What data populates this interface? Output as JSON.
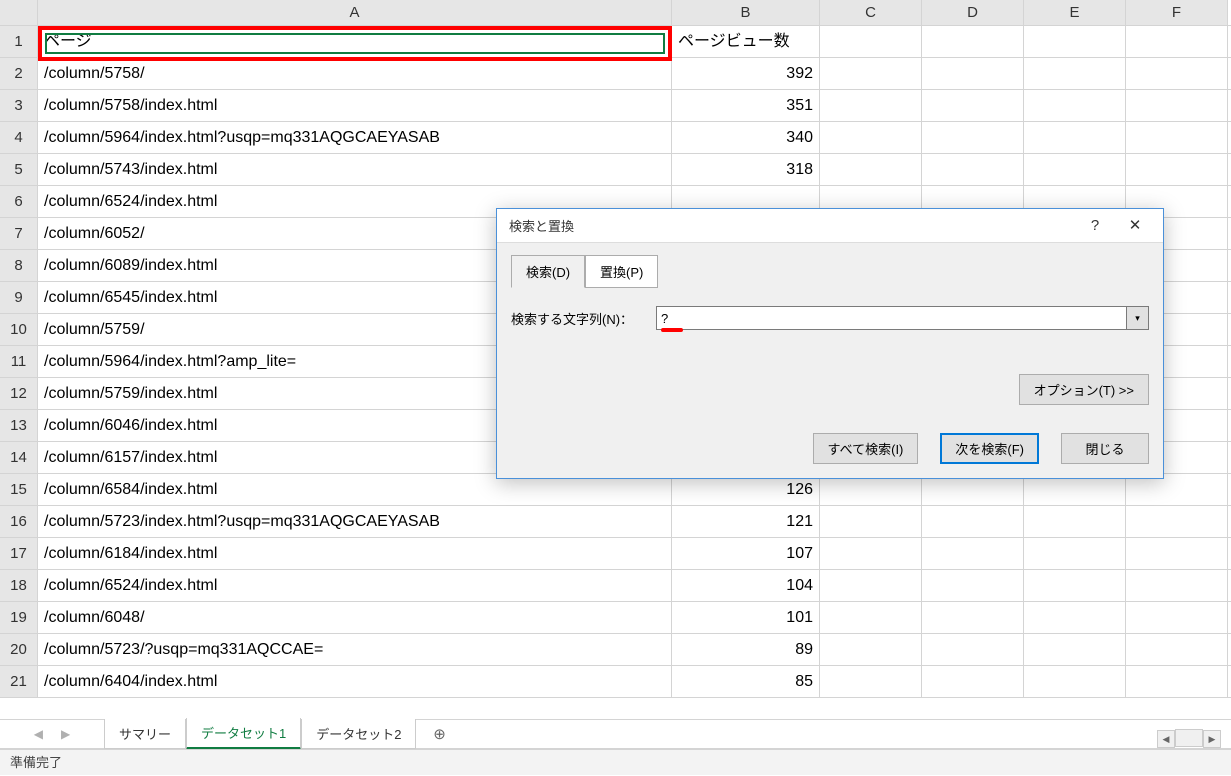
{
  "columns": [
    "A",
    "B",
    "C",
    "D",
    "E",
    "F"
  ],
  "rows": [
    {
      "n": 1,
      "a": "ページ",
      "b": "ページビュー数"
    },
    {
      "n": 2,
      "a": "/column/5758/",
      "b": "392"
    },
    {
      "n": 3,
      "a": "/column/5758/index.html",
      "b": "351"
    },
    {
      "n": 4,
      "a": "/column/5964/index.html?usqp=mq331AQGCAEYASAB",
      "b": "340"
    },
    {
      "n": 5,
      "a": "/column/5743/index.html",
      "b": "318"
    },
    {
      "n": 6,
      "a": "/column/6524/index.html",
      "b": ""
    },
    {
      "n": 7,
      "a": "/column/6052/",
      "b": ""
    },
    {
      "n": 8,
      "a": "/column/6089/index.html",
      "b": ""
    },
    {
      "n": 9,
      "a": "/column/6545/index.html",
      "b": ""
    },
    {
      "n": 10,
      "a": "/column/5759/",
      "b": ""
    },
    {
      "n": 11,
      "a": "/column/5964/index.html?amp_lite=",
      "b": ""
    },
    {
      "n": 12,
      "a": "/column/5759/index.html",
      "b": ""
    },
    {
      "n": 13,
      "a": "/column/6046/index.html",
      "b": ""
    },
    {
      "n": 14,
      "a": "/column/6157/index.html",
      "b": ""
    },
    {
      "n": 15,
      "a": "/column/6584/index.html",
      "b": "126"
    },
    {
      "n": 16,
      "a": "/column/5723/index.html?usqp=mq331AQGCAEYASAB",
      "b": "121"
    },
    {
      "n": 17,
      "a": "/column/6184/index.html",
      "b": "107"
    },
    {
      "n": 18,
      "a": "/column/6524/index.html",
      "b": "104"
    },
    {
      "n": 19,
      "a": "/column/6048/",
      "b": "101"
    },
    {
      "n": 20,
      "a": "/column/5723/?usqp=mq331AQCCAE=",
      "b": "89"
    },
    {
      "n": 21,
      "a": "/column/6404/index.html",
      "b": "85"
    }
  ],
  "dialog": {
    "title": "検索と置換",
    "tab_search": "検索(D)",
    "tab_replace": "置換(P)",
    "label_search_string": "検索する文字列(N)：",
    "search_value": "?",
    "btn_options": "オプション(T) >>",
    "btn_find_all": "すべて検索(I)",
    "btn_find_next": "次を検索(F)",
    "btn_close": "閉じる"
  },
  "sheets": {
    "tab1": "サマリー",
    "tab2": "データセット1",
    "tab3": "データセット2"
  },
  "status": "準備完了"
}
